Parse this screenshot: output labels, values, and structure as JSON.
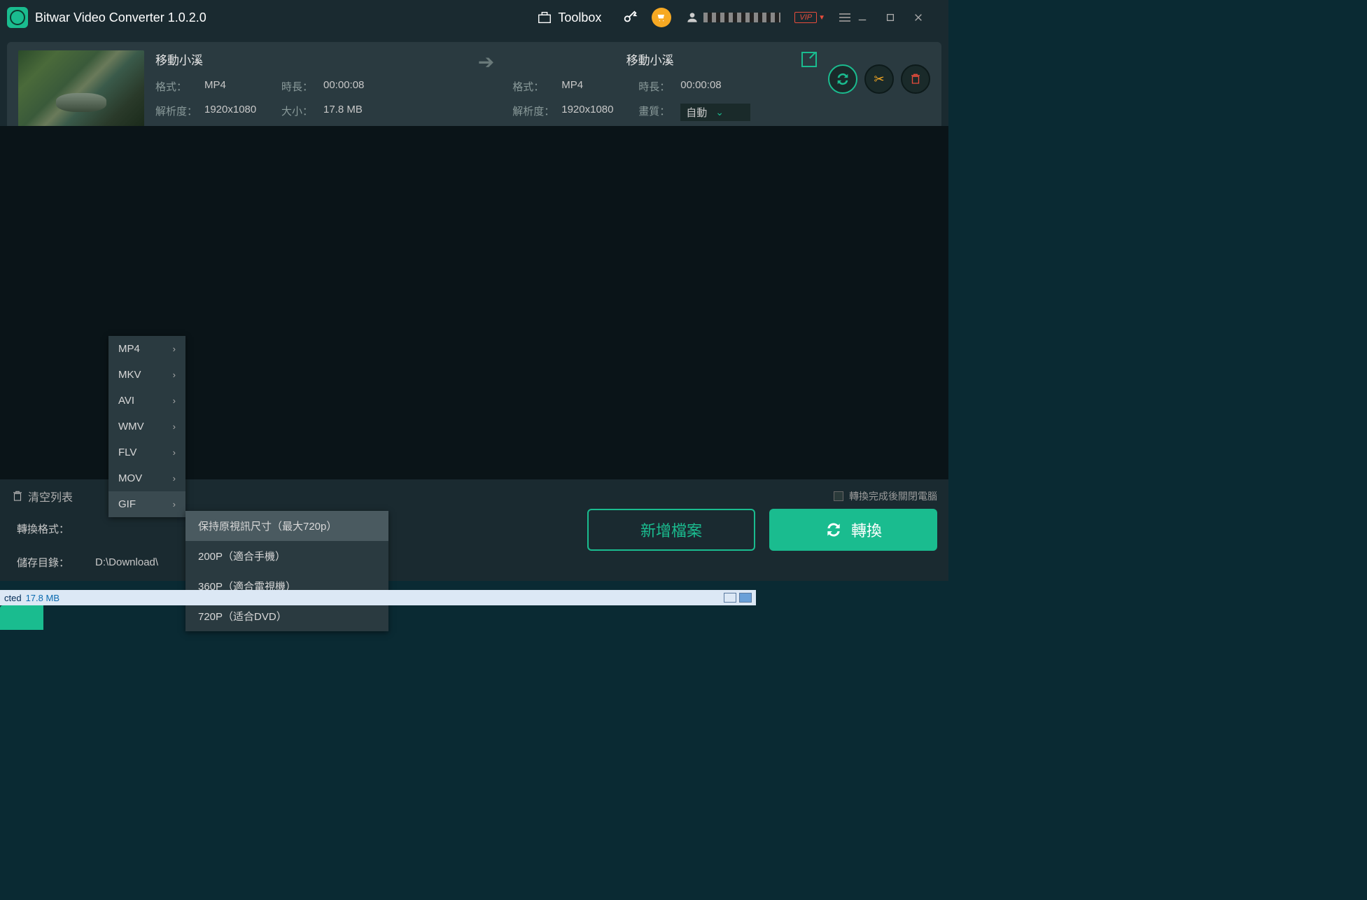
{
  "app": {
    "title": "Bitwar Video Converter  1.0.2.0",
    "toolbox": "Toolbox",
    "vip": "VIP"
  },
  "item": {
    "name": "移動小溪",
    "src": {
      "fmt_lbl": "格式：",
      "fmt": "MP4",
      "dur_lbl": "時長：",
      "dur": "00:00:08",
      "res_lbl": "解析度：",
      "res": "1920x1080",
      "size_lbl": "大小：",
      "size": "17.8 MB"
    },
    "out": {
      "name": "移動小溪",
      "fmt_lbl": "格式：",
      "fmt": "MP4",
      "dur_lbl": "時長：",
      "dur": "00:00:08",
      "res_lbl": "解析度：",
      "res": "1920x1080",
      "q_lbl": "畫質：",
      "q": "自動"
    }
  },
  "bottom": {
    "clear": "清空列表",
    "shutdown": "轉換完成後關閉電腦",
    "fmt_lbl": "轉換格式：",
    "dir_lbl": "儲存目錄：",
    "dir": "D:\\Download\\",
    "add": "新增檔案",
    "convert": "轉換"
  },
  "menu_fmt": [
    "MP4",
    "MKV",
    "AVI",
    "WMV",
    "FLV",
    "MOV",
    "GIF"
  ],
  "menu_gif": [
    "保持原視訊尺寸（最大720p）",
    "200P（適合手機）",
    "360P（適合電視機）",
    "720P（适合DVD）"
  ],
  "taskbar": {
    "sel": "cted",
    "size": "17.8 MB"
  }
}
